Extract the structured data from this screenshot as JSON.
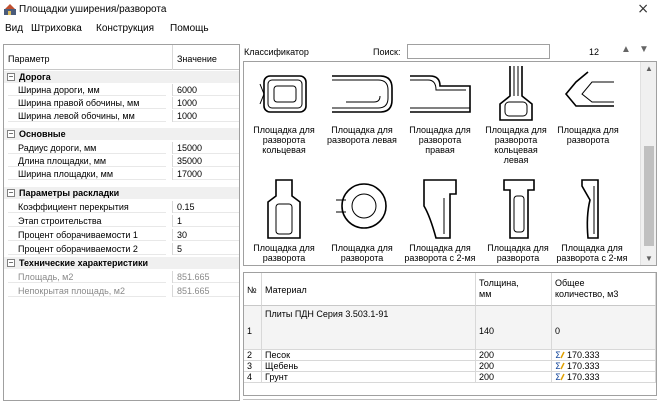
{
  "window": {
    "title": "Площадки уширения/разворота",
    "close_glyph": "×"
  },
  "menu": [
    "Вид",
    "Штриховка",
    "Конструкция",
    "Помощь"
  ],
  "properties": {
    "header": {
      "param": "Параметр",
      "value": "Значение"
    },
    "rows": [
      {
        "type": "category",
        "label": "Дорога"
      },
      {
        "type": "prop",
        "name": "Ширина дороги, мм",
        "value": "6000"
      },
      {
        "type": "prop",
        "name": "Ширина правой обочины, мм",
        "value": "1000"
      },
      {
        "type": "prop",
        "name": "Ширина левой обочины, мм",
        "value": "1000"
      },
      {
        "type": "category",
        "label": "Основные"
      },
      {
        "type": "prop",
        "name": "Радиус дороги, мм",
        "value": "15000"
      },
      {
        "type": "prop",
        "name": "Длина площадки, мм",
        "value": "35000"
      },
      {
        "type": "prop",
        "name": "Ширина площадки, мм",
        "value": "17000"
      },
      {
        "type": "category",
        "label": "Параметры раскладки"
      },
      {
        "type": "prop",
        "name": "Коэффициент перекрытия",
        "value": "0.15"
      },
      {
        "type": "prop",
        "name": "Этап строительства",
        "value": "1"
      },
      {
        "type": "prop",
        "name": "Процент оборачиваемости 1",
        "value": "30"
      },
      {
        "type": "prop",
        "name": "Процент оборачиваемости 2",
        "value": "5"
      },
      {
        "type": "category",
        "label": "Технические характеристики"
      },
      {
        "type": "prop",
        "readonly": true,
        "name": "Площадь, м2",
        "value": "851.665"
      },
      {
        "type": "prop",
        "readonly": true,
        "name": "Непокрытая площадь, м2",
        "value": "851.665"
      }
    ]
  },
  "classifier": {
    "label": "Классификатор",
    "search_label": "Поиск:",
    "search_value": "",
    "count": "12",
    "icons": {
      "up": "arrow-up-icon",
      "down": "arrow-down-icon"
    },
    "items": [
      {
        "icon": "platform-ring-icon",
        "lines": [
          "Площадка для",
          "разворота",
          "кольцевая"
        ]
      },
      {
        "icon": "platform-left-icon",
        "lines": [
          "Площадка для",
          "разворота левая"
        ]
      },
      {
        "icon": "platform-right-icon",
        "lines": [
          "Площадка для",
          "разворота",
          "правая"
        ]
      },
      {
        "icon": "platform-ring-left-icon",
        "lines": [
          "Площадка для",
          "разворота",
          "кольцевая",
          "левая"
        ]
      },
      {
        "icon": "platform-turn-icon",
        "lines": [
          "Площадка для",
          "разворота"
        ]
      },
      {
        "icon": "platform-t-icon",
        "lines": [
          "Площадка для",
          "разворота"
        ]
      },
      {
        "icon": "platform-circle-icon",
        "lines": [
          "Площадка для",
          "разворота"
        ]
      },
      {
        "icon": "platform-2way-icon",
        "lines": [
          "Площадка для",
          "разворота с 2-мя"
        ]
      },
      {
        "icon": "platform-ring2-icon",
        "lines": [
          "Площадка для",
          "разворота"
        ]
      },
      {
        "icon": "platform-2way-b-icon",
        "lines": [
          "Площадка для",
          "разворота с 2-мя"
        ]
      }
    ]
  },
  "materials": {
    "headers": {
      "num": "№",
      "material": "Материал",
      "thickness": [
        "Толщина,",
        "мм"
      ],
      "volume": [
        "Общее",
        "количество, м3"
      ]
    },
    "rows": [
      {
        "num": "1",
        "material": "Плиты ПДН Серия 3.503.1-91",
        "thickness": "140",
        "volume": "0"
      },
      {
        "num": "2",
        "material": "Песок",
        "thickness": "200",
        "volume": "170.333"
      },
      {
        "num": "3",
        "material": "Щебень",
        "thickness": "200",
        "volume": "170.333"
      },
      {
        "num": "4",
        "material": "Грунт",
        "thickness": "200",
        "volume": "170.333"
      }
    ]
  }
}
